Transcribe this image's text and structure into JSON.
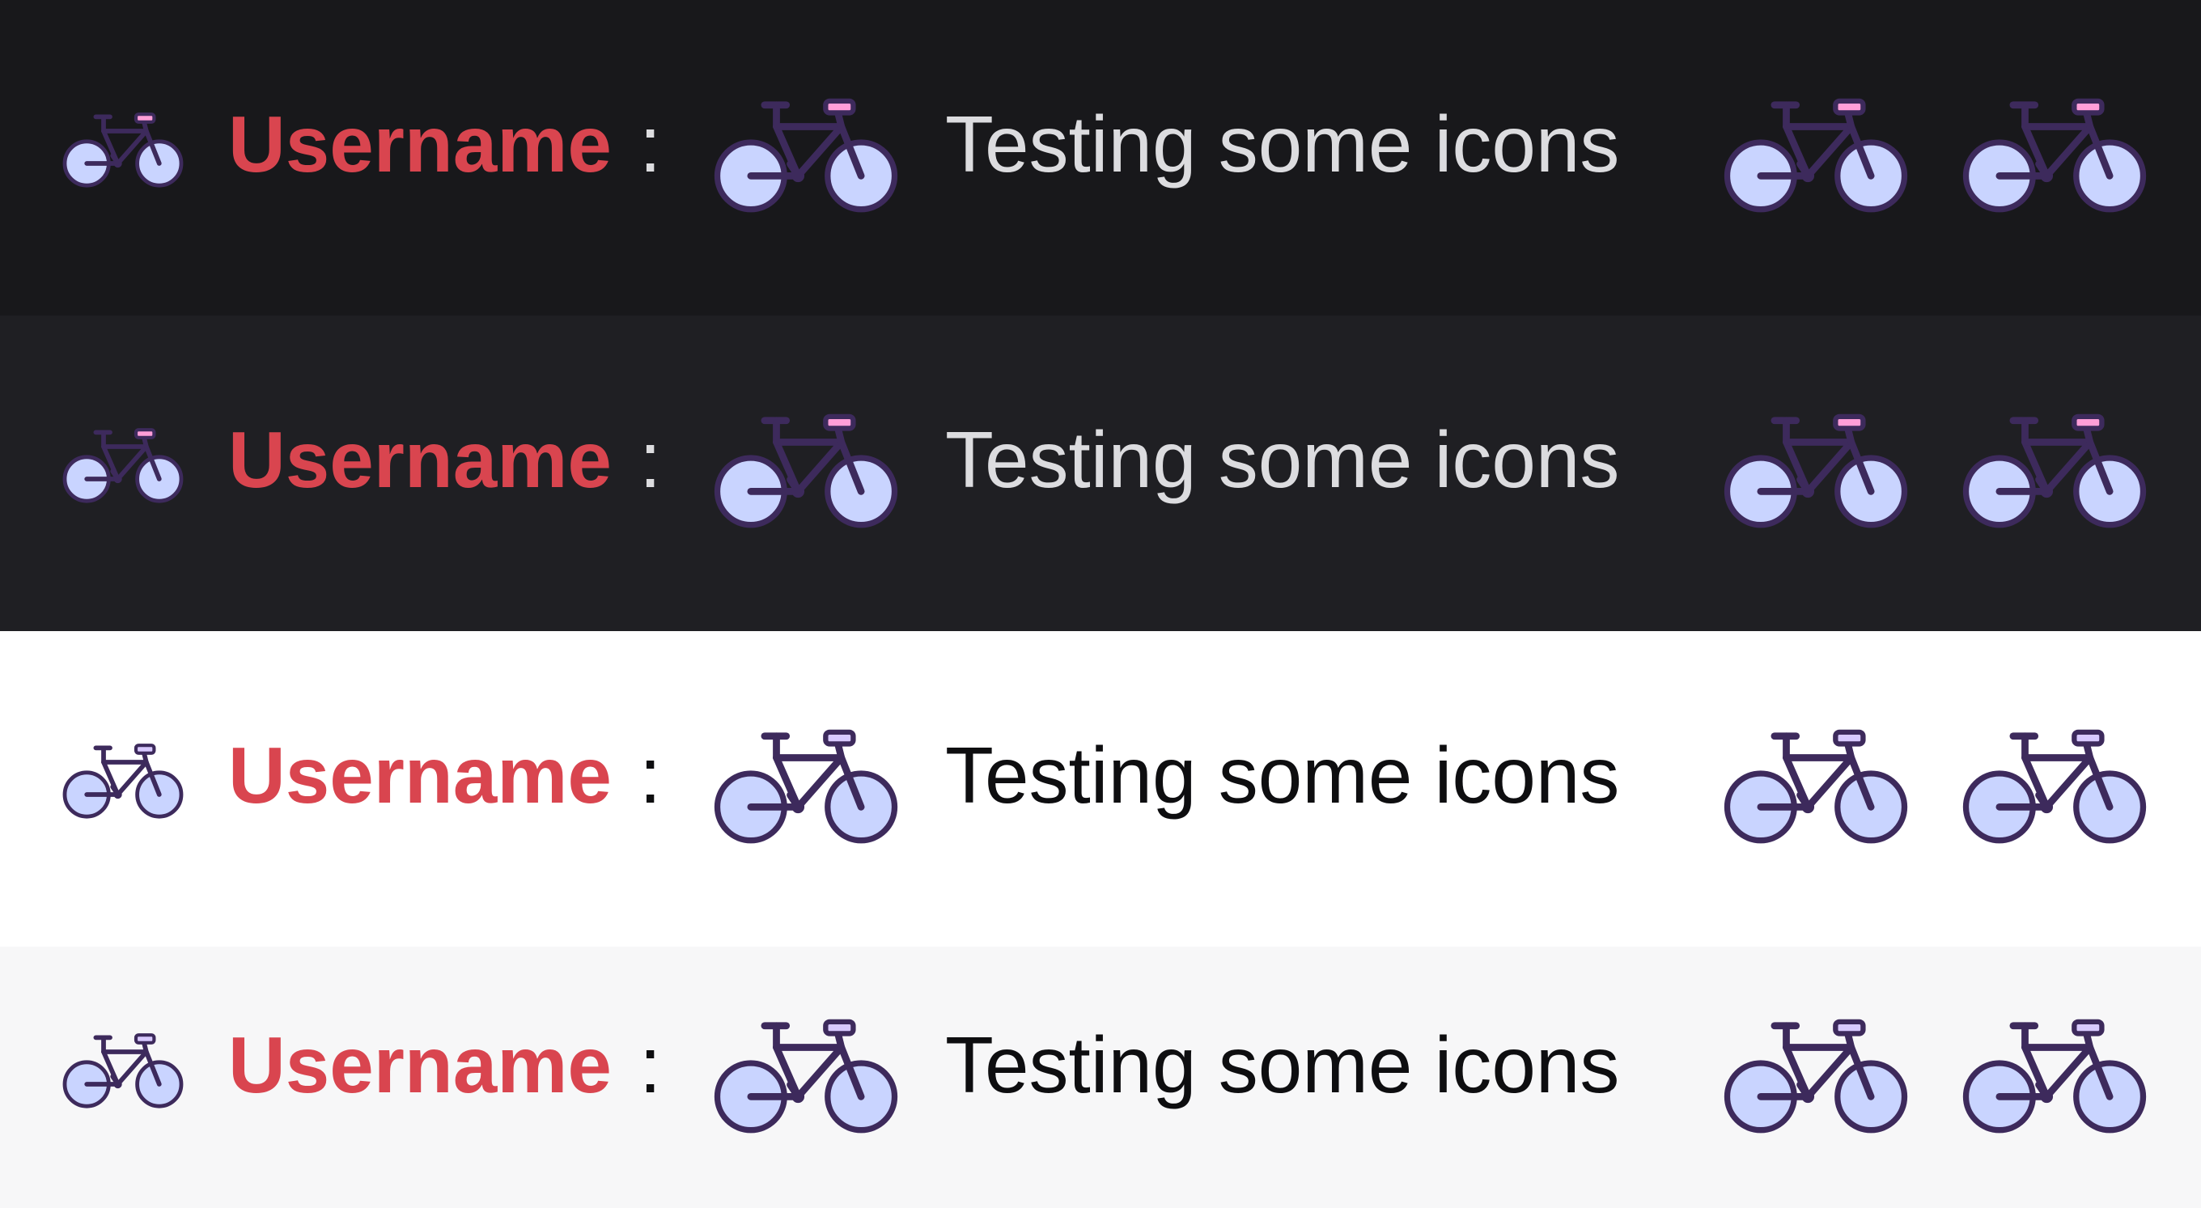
{
  "colors": {
    "username": "#d9454f",
    "wheel_fill": "#c9d4ff",
    "frame_stroke": "#3d2a5c",
    "saddle_dark": "#ff9ed8",
    "saddle_light": "#d8c9ff"
  },
  "icons": {
    "badge": "bicycle-icon",
    "emote": "bicycle-icon"
  },
  "rows": [
    {
      "theme": "dark",
      "background": "#18181b",
      "text_color": "#dcdcdf",
      "username": "Username",
      "colon": ":",
      "message": "Testing some icons"
    },
    {
      "theme": "dark-alt",
      "background": "#1f1f23",
      "text_color": "#dcdcdf",
      "username": "Username",
      "colon": ":",
      "message": "Testing some icons"
    },
    {
      "theme": "light",
      "background": "#ffffff",
      "text_color": "#0e0e10",
      "username": "Username",
      "colon": ":",
      "message": "Testing some icons"
    },
    {
      "theme": "light-alt",
      "background": "#f7f7f8",
      "text_color": "#0e0e10",
      "username": "Username",
      "colon": ":",
      "message": "Testing some icons"
    }
  ]
}
